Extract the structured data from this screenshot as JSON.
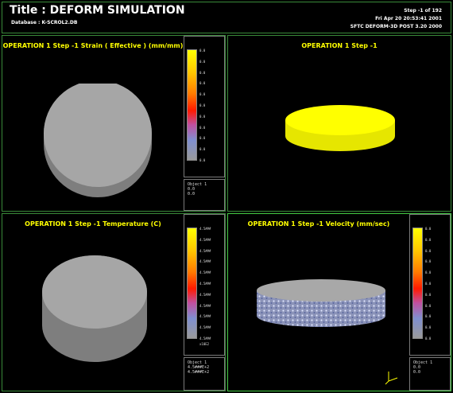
{
  "header": {
    "title": "Title : DEFORM SIMULATION",
    "database": "Database : K-SCROL2.DB",
    "step": "Step -1 of 192",
    "date": "Fri Apr 20 20:53:41 2001",
    "version": "SFTC DEFORM-3D POST 3.20 2000"
  },
  "panels": {
    "strain": {
      "title": "OPERATION 1 Step -1  Strain ( Effective )  (mm/mm)",
      "ticks": [
        "0.0",
        "0.0",
        "0.0",
        "0.0",
        "0.0",
        "0.0",
        "0.0",
        "0.0",
        "0.0",
        "0.0",
        "0.0"
      ],
      "info": [
        "Object  1",
        "0.0",
        "0.0"
      ]
    },
    "view": {
      "title": "OPERATION 1 Step -1"
    },
    "temperature": {
      "title": "OPERATION 1 Step -1  Temperature (C)",
      "ticks": [
        "4.5###",
        "4.5###",
        "4.5###",
        "4.5###",
        "4.5###",
        "4.5###",
        "4.5###",
        "4.5###",
        "4.5###",
        "4.5###",
        "4.5###"
      ],
      "exponent": "x10E2",
      "info": [
        "Object  1",
        "4.5###E+2",
        "4.5###E+2"
      ]
    },
    "velocity": {
      "title": "OPERATION 1 Step -1  Velocity (mm/sec)",
      "ticks": [
        "0.0",
        "0.0",
        "0.0",
        "0.0",
        "0.0",
        "0.0",
        "0.0",
        "0.0",
        "0.0",
        "0.0",
        "0.0"
      ],
      "info": [
        "Object  1",
        "0.0",
        "0.0"
      ]
    }
  },
  "colors": {
    "frame": "#3a8a3a",
    "active_frame": "#44cc44",
    "title_text": "#ffff00",
    "part_gray": "#9c9c9c",
    "part_yellow": "#ffff00"
  }
}
